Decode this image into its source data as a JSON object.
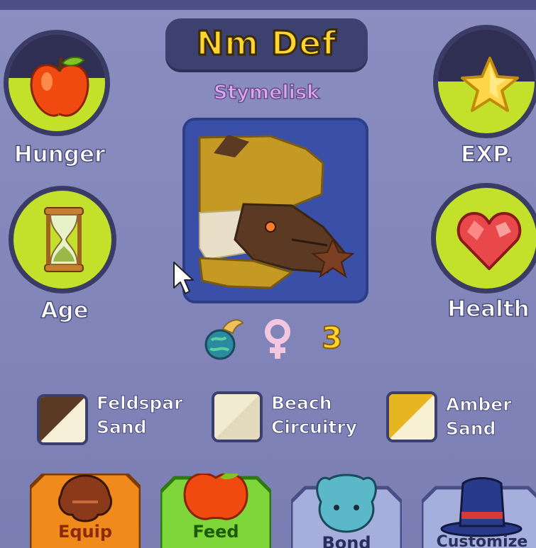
{
  "pet": {
    "name": "Nm Def",
    "species": "Stymelisk",
    "level": "3"
  },
  "stats": {
    "hunger": {
      "label": "Hunger",
      "icon": "apple-icon",
      "fill": 0.55
    },
    "exp": {
      "label": "EXP.",
      "icon": "star-icon",
      "fill": 0.5
    },
    "age": {
      "label": "Age",
      "icon": "hourglass-icon",
      "fill": 1.0
    },
    "health": {
      "label": "Health",
      "icon": "heart-icon",
      "fill": 1.0
    }
  },
  "colors": {
    "accent_yellow": "#ffd52e",
    "fill_green": "#c3e02a",
    "panel_bg": "#8286ba",
    "species_purple": "#d9a8f0"
  },
  "swatches": [
    {
      "line1": "Feldspar",
      "line2": "Sand",
      "color_a": "#5a3a22",
      "color_b": "#f5efd8"
    },
    {
      "line1": "Beach",
      "line2": "Circuitry",
      "color_a": "#f3ead2",
      "color_b": "#e3d9bd"
    },
    {
      "line1": "Amber",
      "line2": "Sand",
      "color_a": "#e7b422",
      "color_b": "#f7f0d2"
    }
  ],
  "actions": {
    "equip": "Equip",
    "feed": "Feed",
    "bond": "Bond",
    "customize": "Customize"
  },
  "badges": {
    "element": "globe-dragon-icon",
    "gender": "female-symbol-icon"
  }
}
